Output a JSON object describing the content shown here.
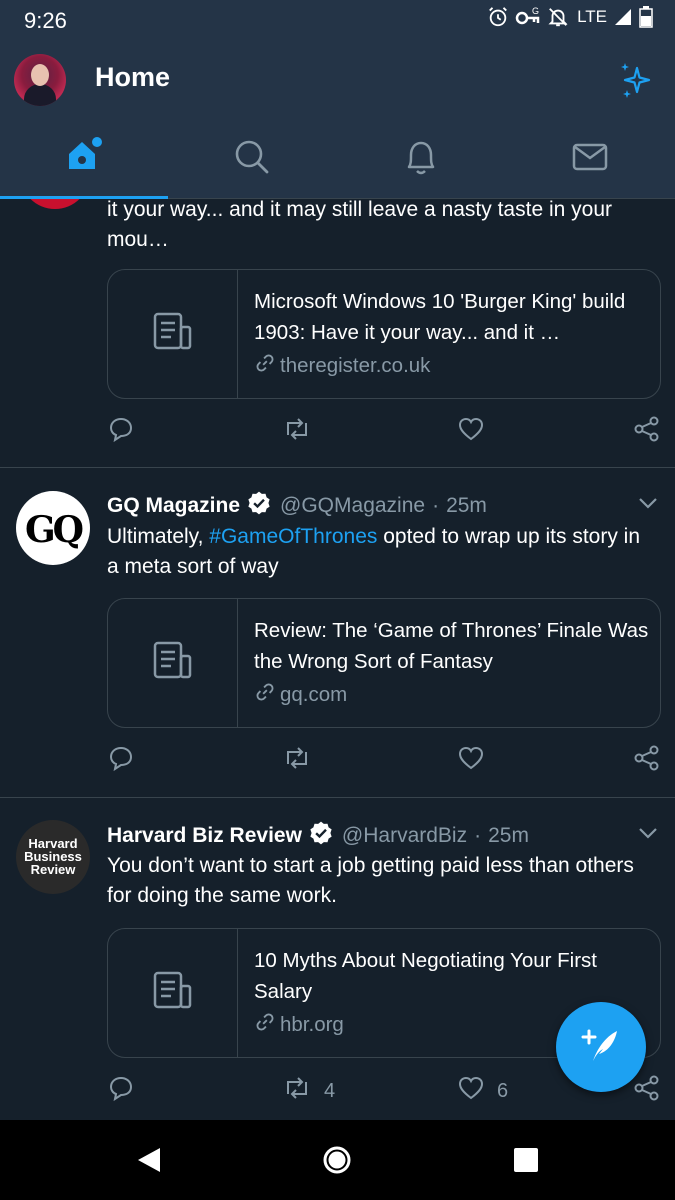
{
  "status_bar": {
    "time": "9:26",
    "network": "LTE"
  },
  "header": {
    "title": "Home"
  },
  "tabs": [
    {
      "name": "home"
    },
    {
      "name": "search"
    },
    {
      "name": "notifications"
    },
    {
      "name": "messages"
    }
  ],
  "tweets": [
    {
      "text": "it your way... and it may still leave a nasty taste in your mou…",
      "card": {
        "title": "Microsoft Windows 10 'Burger King' build 1903: Have it your way... and it …",
        "domain": "theregister.co.uk"
      },
      "retweets": "",
      "likes": ""
    },
    {
      "name": "GQ Magazine",
      "handle": "@GQMagazine",
      "dot": "·",
      "time": "25m",
      "avatar_text": "GQ",
      "text_before": "Ultimately, ",
      "hashtag": "#GameOfThrones",
      "text_after": " opted to wrap up its story in a meta sort of way",
      "card": {
        "title": "Review: The ‘Game of Thrones’ Finale Was the Wrong Sort of Fantasy",
        "domain": "gq.com"
      },
      "retweets": "",
      "likes": ""
    },
    {
      "name": "Harvard Biz Review",
      "handle": "@HarvardBiz",
      "dot": "·",
      "time": "25m",
      "avatar_lines": [
        "Harvard",
        "Business",
        "Review"
      ],
      "text": "You don’t want to start a job getting paid less than others for doing the same work.",
      "card": {
        "title": "10 Myths About Negotiating Your First Salary",
        "domain": "hbr.org"
      },
      "retweets": "4",
      "likes": "6"
    }
  ],
  "colors": {
    "accent": "#1da1f2",
    "background": "#15202b",
    "header": "#243447",
    "muted": "#8899a6",
    "border": "#38444d"
  }
}
